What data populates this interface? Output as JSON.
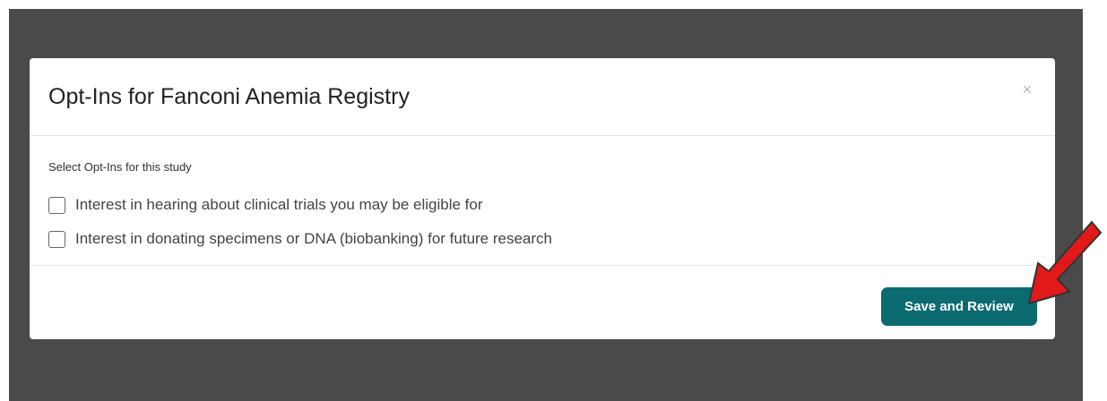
{
  "modal": {
    "title": "Opt-Ins for Fanconi Anemia Registry",
    "close_symbol": "×",
    "section_label": "Select Opt-Ins for this study",
    "options": [
      {
        "label": "Interest in hearing about clinical trials you may be eligible for",
        "checked": false
      },
      {
        "label": "Interest in donating specimens or DNA (biobanking) for future research",
        "checked": false
      }
    ],
    "save_label": "Save and Review"
  },
  "colors": {
    "backdrop": "#4a4a4a",
    "primary_button": "#0c6b70",
    "annotation_arrow": "#e11919"
  },
  "icons": {
    "close": "close-icon",
    "annotation": "red-arrow-icon"
  }
}
